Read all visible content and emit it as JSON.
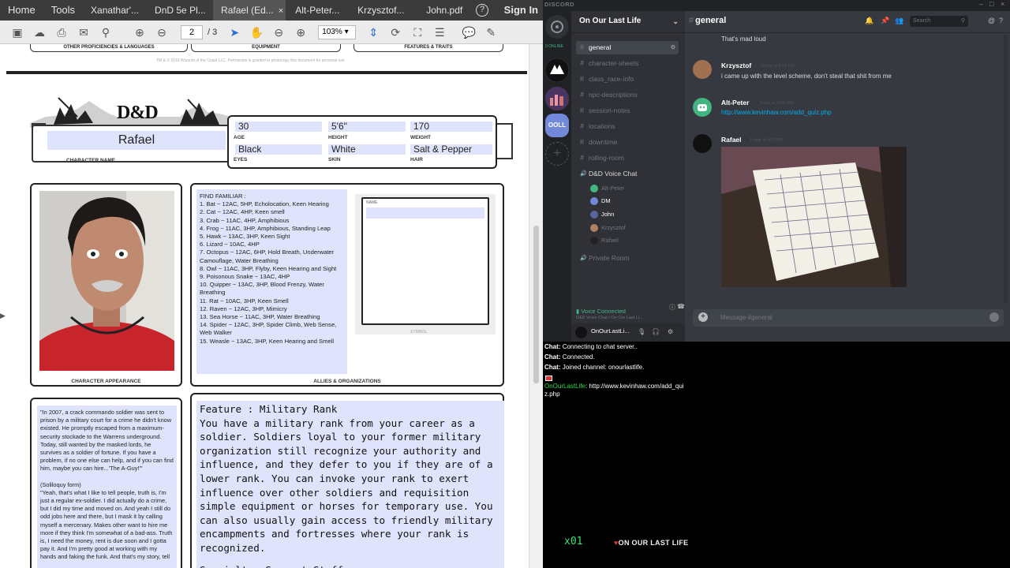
{
  "pdf": {
    "tabs": {
      "home": "Home",
      "tools": "Tools",
      "docs": [
        "Xanathar'...",
        "DnD 5e Pl...",
        "Rafael (Ed...",
        "Alt-Peter...",
        "Krzysztof...",
        "John.pdf"
      ],
      "close_glyph": "×",
      "help_glyph": "?",
      "signin": "Sign In"
    },
    "toolbar": {
      "page_current": "2",
      "page_total": "/ 3",
      "zoom": "103%"
    },
    "sheet": {
      "top_boxes": [
        "OTHER PROFICIENCIES & LANGUAGES",
        "EQUIPMENT",
        "FEATURES & TRAITS"
      ],
      "fine_print": "TM & © 2016 Wizards of the Coast LLC. Permission is granted to photocopy this document for personal use.",
      "logo": "D&D",
      "character_name": "Rafael",
      "character_name_label": "CHARACTER NAME",
      "stats": [
        {
          "value": "30",
          "label": "AGE"
        },
        {
          "value": "5'6\"",
          "label": "HEIGHT"
        },
        {
          "value": "170",
          "label": "WEIGHT"
        },
        {
          "value": "Black",
          "label": "EYES"
        },
        {
          "value": "White",
          "label": "SKIN"
        },
        {
          "value": "Salt & Pepper",
          "label": "HAIR"
        }
      ],
      "appearance_label": "CHARACTER APPEARANCE",
      "allies_label": "ALLIES & ORGANIZATIONS",
      "org_name_label": "NAME",
      "org_symbol_label": "SYMBOL",
      "familiar": [
        "FIND FAMILIAR :",
        "1. Bat ~ 12AC, 5HP, Echolocation, Keen Hearing",
        "2. Cat ~ 12AC, 4HP, Keen smell",
        "3. Crab ~ 11AC, 4HP, Amphibious",
        "4. Frog ~ 11AC, 3HP, Amphibious, Standing Leap",
        "5. Hawk ~ 13AC, 3HP, Keen Sight",
        "6. Lizard ~ 10AC, 4HP",
        "7. Octopus ~ 12AC, 6HP, Hold Breath, Underwater Camouflage, Water Breathing",
        "8. Owl ~ 11AC, 3HP, Flyby, Keen Hearing and Sight",
        "9. Poisonous Snake ~ 13AC, 4HP",
        "10. Quipper ~ 13AC, 3HP, Blood Frenzy, Water Breathing",
        "11. Rat ~ 10AC, 3HP, Keen Smell",
        "12. Raven ~ 12AC, 3HP, Mimicry",
        "13. Sea Horse ~ 11AC, 3HP, Water Breathing",
        "14. Spider ~ 12AC, 3HP, Spider Climb, Web Sense, Web Walker",
        "15. Weasle ~ 13AC, 3HP, Keen Hearing and Smell"
      ],
      "backstory": [
        "\"In 2007, a crack commando soldier was sent to prison by a military court for a crime he didn't know existed. He promptly escaped from a maximum-security stockade to the Warrens underground. Today, still wanted by the masked lords, he survives as a soldier of fortune. If you have a problem, if no one else can help, and if you can find him, maybe you can hire...'The A-Guy!'\"",
        "",
        "(Soliloquy form)",
        "\"Yeah, that's what I like to tell people, truth is, I'm just a regular ex-soldier.  I did actually do a crime, but I did my time and moved on.  And yeah I still do odd jobs here and there, but I mask it by calling myself a mercenary. Makes other want to hire me more if they think I'm somewhat of a bad-ass.  Truth is, I need the money, rent is due soon and I gotta pay it. And I'm pretty good at working with my hands and faking the funk.  And that's my story, tell"
      ],
      "feature": [
        "Feature : Military Rank",
        "You have a military rank from your career as a soldier. Soldiers loyal to your former military organization still recognize your authority and influence, and they defer to you if they are of a lower rank. You can invoke your rank to exert influence over other soldiers and requisition simple equipment or horses for temporary use. You can also usually gain access to friendly military encampments and fortresses where your rank is recognized.",
        "",
        "Specialty: Support Staff (Electronics,Weapons,Vehicles)"
      ]
    }
  },
  "discord": {
    "brand": "DISCORD",
    "online_label": "0 ONLINE",
    "guild_label": "OOLL",
    "server_name": "On Our Last Life",
    "channels": [
      "general",
      "character-sheets",
      "class_race-info",
      "npc-descriptions",
      "session-notes",
      "locations",
      "downtime",
      "rolling-room"
    ],
    "voice_channel": "D&D Voice Chat",
    "voice_users": [
      "Alt-Peter",
      "DM",
      "John",
      "Krzysztof",
      "Rafael"
    ],
    "private_room": "Private Room",
    "voice_connected": "Voice Connected",
    "voice_sub": "D&D Voice Chat / On Our Last Li...",
    "me": "OnOurLastLi...",
    "chat": {
      "channel": "general",
      "search_placeholder": "Search",
      "messages": [
        {
          "author": "",
          "text": "That's mad loud"
        },
        {
          "author": "Krzysztof",
          "ts": "Today at 8:59 PM",
          "text": "i came up with the level scheme, don't steal that shit from me"
        },
        {
          "author": "Alt-Peter",
          "ts": "Today at 9:00 PM",
          "text": "http://www.kevinhaw.com/add_quiz.php"
        },
        {
          "author": "Rafael",
          "ts": "Today at 9:02 PM",
          "text": ""
        }
      ],
      "input_placeholder": "Message #general"
    }
  },
  "stream": {
    "lines": [
      {
        "prefix": "Chat:",
        "text": "Connecting to chat server.."
      },
      {
        "prefix": "Chat:",
        "text": "Connected."
      },
      {
        "prefix": "Chat:",
        "text": "Joined channel: onourlastlife."
      }
    ],
    "user_msg": {
      "user": "OnOurLastLife",
      "text": ": http://www.kevinhaw.com/add_qui",
      "text2": "z.php"
    },
    "overlay_count": "x01",
    "overlay_title": "ON OUR LAST LIFE"
  },
  "colors": {
    "field_fill": "#dfe3fb",
    "discord_bg": "#36393f",
    "discord_link": "#00b0f4",
    "voice_green": "#43b581",
    "stream_user_green": "#2bd84b"
  }
}
